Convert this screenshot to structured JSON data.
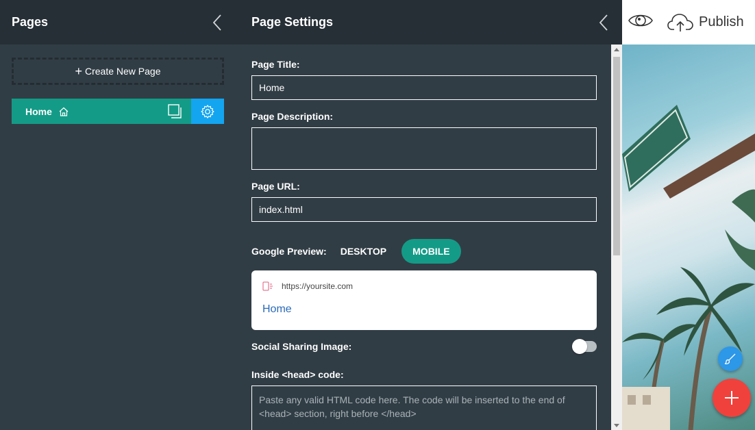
{
  "pages_panel": {
    "title": "Pages",
    "create_label": "Create New Page",
    "items": [
      {
        "label": "Home"
      }
    ]
  },
  "settings_panel": {
    "title": "Page Settings",
    "page_title_label": "Page Title:",
    "page_title_value": "Home",
    "page_description_label": "Page Description:",
    "page_description_value": "",
    "page_url_label": "Page URL:",
    "page_url_value": "index.html",
    "google_preview_label": "Google Preview:",
    "desktop_label": "DESKTOP",
    "mobile_label": "MOBILE",
    "preview": {
      "url": "https://yoursite.com",
      "title": "Home"
    },
    "social_sharing_label": "Social Sharing Image:",
    "head_code_label": "Inside <head> code:",
    "head_code_placeholder": "Paste any valid HTML code here. The code will be inserted to the end of <head> section, right before </head>"
  },
  "topbar": {
    "publish_label": "Publish"
  },
  "colors": {
    "accent": "#149b87",
    "settings_blue": "#13a5f0",
    "fab_red": "#f1413c",
    "fab_blue": "#2d97e8"
  }
}
